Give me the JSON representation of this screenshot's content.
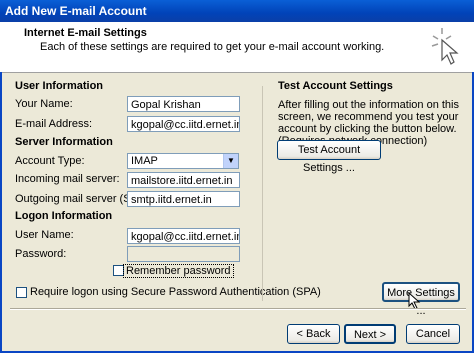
{
  "window": {
    "title": "Add New E-mail Account"
  },
  "header": {
    "title": "Internet E-mail Settings",
    "subtitle": "Each of these settings are required to get your e-mail account working."
  },
  "user_info": {
    "heading": "User Information",
    "name_label": "Your Name:",
    "name_value": "Gopal Krishan",
    "email_label": "E-mail Address:",
    "email_value": "kgopal@cc.iitd.ernet.in"
  },
  "server_info": {
    "heading": "Server Information",
    "account_type_label": "Account Type:",
    "account_type_value": "IMAP",
    "incoming_label": "Incoming mail server:",
    "incoming_value": "mailstore.iitd.ernet.in",
    "outgoing_label": "Outgoing mail server (SMTP):",
    "outgoing_value": "smtp.iitd.ernet.in"
  },
  "logon_info": {
    "heading": "Logon Information",
    "user_label": "User Name:",
    "user_value": "kgopal@cc.iitd.ernet.in",
    "password_label": "Password:",
    "password_value": "",
    "remember_label": "Remember password",
    "remember_checked": false,
    "spa_label": "Require logon using Secure Password Authentication (SPA)",
    "spa_checked": false
  },
  "test": {
    "heading": "Test Account Settings",
    "description": "After filling out the information on this screen, we recommend you test your account by clicking the button below. (Requires network connection)",
    "button": "Test Account Settings ..."
  },
  "buttons": {
    "more_settings": "More Settings ...",
    "back": "< Back",
    "next": "Next >",
    "cancel": "Cancel"
  }
}
